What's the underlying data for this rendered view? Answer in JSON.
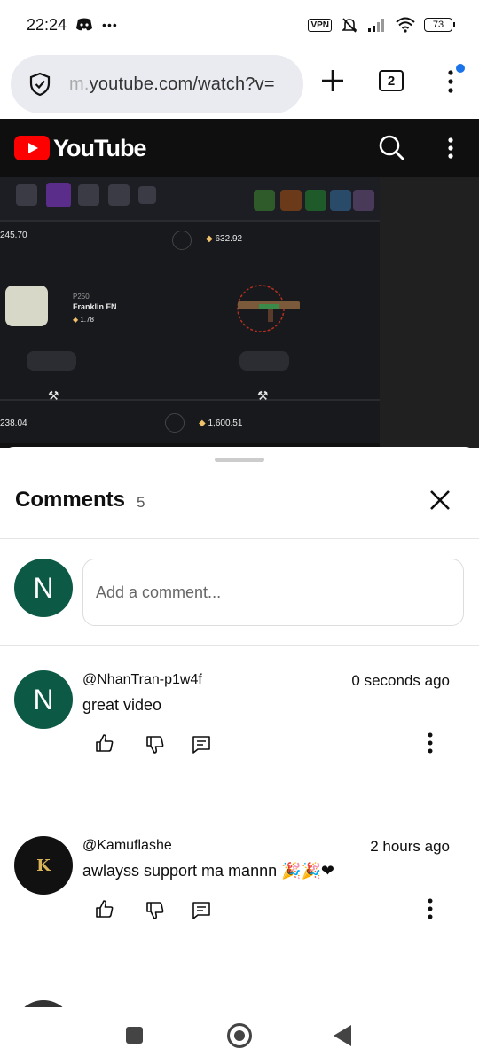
{
  "status_bar": {
    "time": "22:24",
    "more_indicator": "•••",
    "vpn_label": "VPN",
    "battery": "73"
  },
  "browser": {
    "url_prefix": "m.",
    "url_main": "youtube.com/watch?v=",
    "tab_count": "2"
  },
  "youtube": {
    "wordmark": "YouTube"
  },
  "video": {
    "values": {
      "left_top": "245.70",
      "center_top": "632.92",
      "item_model": "P250",
      "item_name": "Franklin FN",
      "item_price": "1.78",
      "left_bottom": "238.04",
      "center_bottom": "1,600.51"
    }
  },
  "comments": {
    "title": "Comments",
    "count": "5",
    "add_placeholder": "Add a comment...",
    "user_avatar_letter": "N",
    "items": [
      {
        "avatar_letter": "N",
        "handle": "@NhanTran-p1w4f",
        "time": "0 seconds ago",
        "text": "great video"
      },
      {
        "avatar_letter": "K",
        "handle": "@Kamuflashe",
        "time": "2 hours ago",
        "text": "awlayss support ma mannn 🎉🎉❤"
      }
    ]
  },
  "colors": {
    "youtube_red": "#ff0000",
    "avatar_green": "#0c5a45",
    "header_dark": "#0f0f0f",
    "notif_blue": "#1a73e8"
  }
}
